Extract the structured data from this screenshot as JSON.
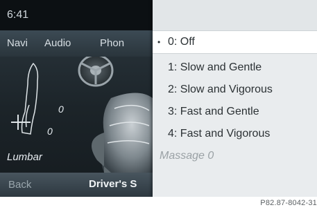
{
  "status": {
    "time": "6:41"
  },
  "nav": {
    "items": [
      "Navi",
      "Audio",
      "Phon"
    ]
  },
  "seat_view": {
    "upper_value": "0",
    "lower_value": "0",
    "lumbar_label": "Lumbar"
  },
  "bottom": {
    "back_label": "Back",
    "seat_label": "Driver's S"
  },
  "menu": {
    "selected_bullet": "•",
    "items": [
      "0: Off",
      "1: Slow and Gentle",
      "2: Slow and Vigorous",
      "3: Fast and Gentle",
      "4: Fast and Vigorous"
    ],
    "selected_index": 0,
    "massage_status": "Massage  0"
  },
  "caption": "P82.87-8042-31"
}
